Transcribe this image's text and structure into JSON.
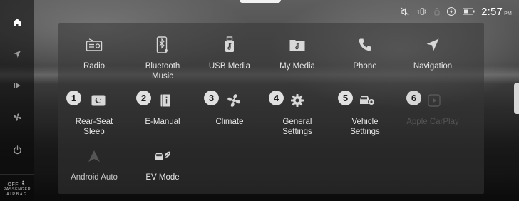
{
  "status": {
    "clock": "2:57",
    "ampm": "PM"
  },
  "airbag": {
    "state": "OFF",
    "line1": "PASSENGER",
    "line2": "AIRBAG"
  },
  "rail": {
    "items": [
      {
        "icon": "home-icon",
        "active": true
      },
      {
        "icon": "navigation-arrow-icon",
        "active": false
      },
      {
        "icon": "media-play-icon",
        "active": false
      },
      {
        "icon": "fan-icon",
        "active": false
      },
      {
        "icon": "power-icon",
        "active": false
      }
    ]
  },
  "apps": [
    {
      "label": "Radio",
      "icon": "radio-icon"
    },
    {
      "label": "Bluetooth\nMusic",
      "icon": "bluetooth-music-icon"
    },
    {
      "label": "USB Media",
      "icon": "usb-media-icon"
    },
    {
      "label": "My Media",
      "icon": "folder-music-icon"
    },
    {
      "label": "Phone",
      "icon": "phone-icon"
    },
    {
      "label": "Navigation",
      "icon": "navigation-icon"
    },
    {
      "label": "Rear-Seat\nSleep",
      "icon": "sleep-icon",
      "badge": "1"
    },
    {
      "label": "E-Manual",
      "icon": "book-icon",
      "badge": "2"
    },
    {
      "label": "Climate",
      "icon": "fan-icon",
      "badge": "3"
    },
    {
      "label": "General\nSettings",
      "icon": "gear-icon",
      "badge": "4"
    },
    {
      "label": "Vehicle\nSettings",
      "icon": "car-settings-icon",
      "badge": "5"
    },
    {
      "label": "Apple CarPlay",
      "icon": "carplay-icon",
      "badge": "6",
      "disabled": true
    },
    {
      "label": "Android Auto",
      "icon": "android-auto-icon",
      "disabled": true
    },
    {
      "label": "EV Mode",
      "icon": "ev-mode-icon"
    }
  ]
}
